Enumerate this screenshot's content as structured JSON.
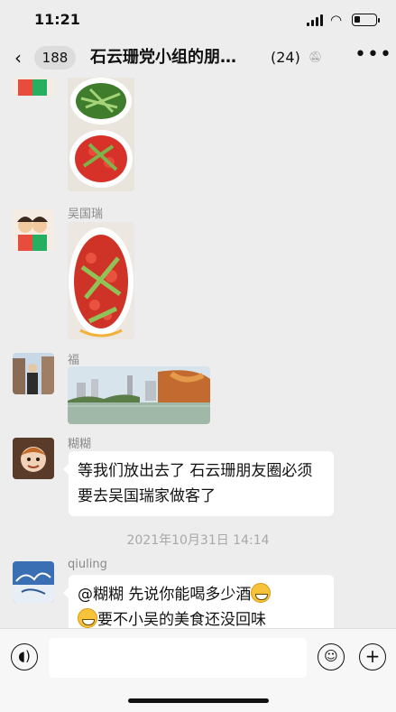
{
  "status_bar": {
    "time": "11:21"
  },
  "nav": {
    "unread_badge": "188",
    "title": "石云珊党小组的朋…",
    "member_count": "(24)"
  },
  "messages": [
    {
      "sender": "",
      "kind": "images"
    },
    {
      "sender": "吴国瑞",
      "kind": "image"
    },
    {
      "sender": "福",
      "kind": "image"
    },
    {
      "sender": "糊糊",
      "kind": "text",
      "text": "等我们放出去了 石云珊朋友圈必须要去吴国瑞家做客了"
    },
    {
      "timestamp": "2021年10月31日 14:14"
    },
    {
      "sender": "qiuling",
      "kind": "text",
      "text_line1": "@糊糊 先说你能喝多少酒",
      "text_line2": "要不小吴的美食还没回味"
    }
  ],
  "input_bar": {
    "placeholder": ""
  },
  "icons": {
    "back": "chevron-left-icon",
    "mute": "mute-bell-icon",
    "more": "more-dots-icon",
    "voice": "voice-icon",
    "emoji": "emoji-icon",
    "add": "plus-icon"
  }
}
